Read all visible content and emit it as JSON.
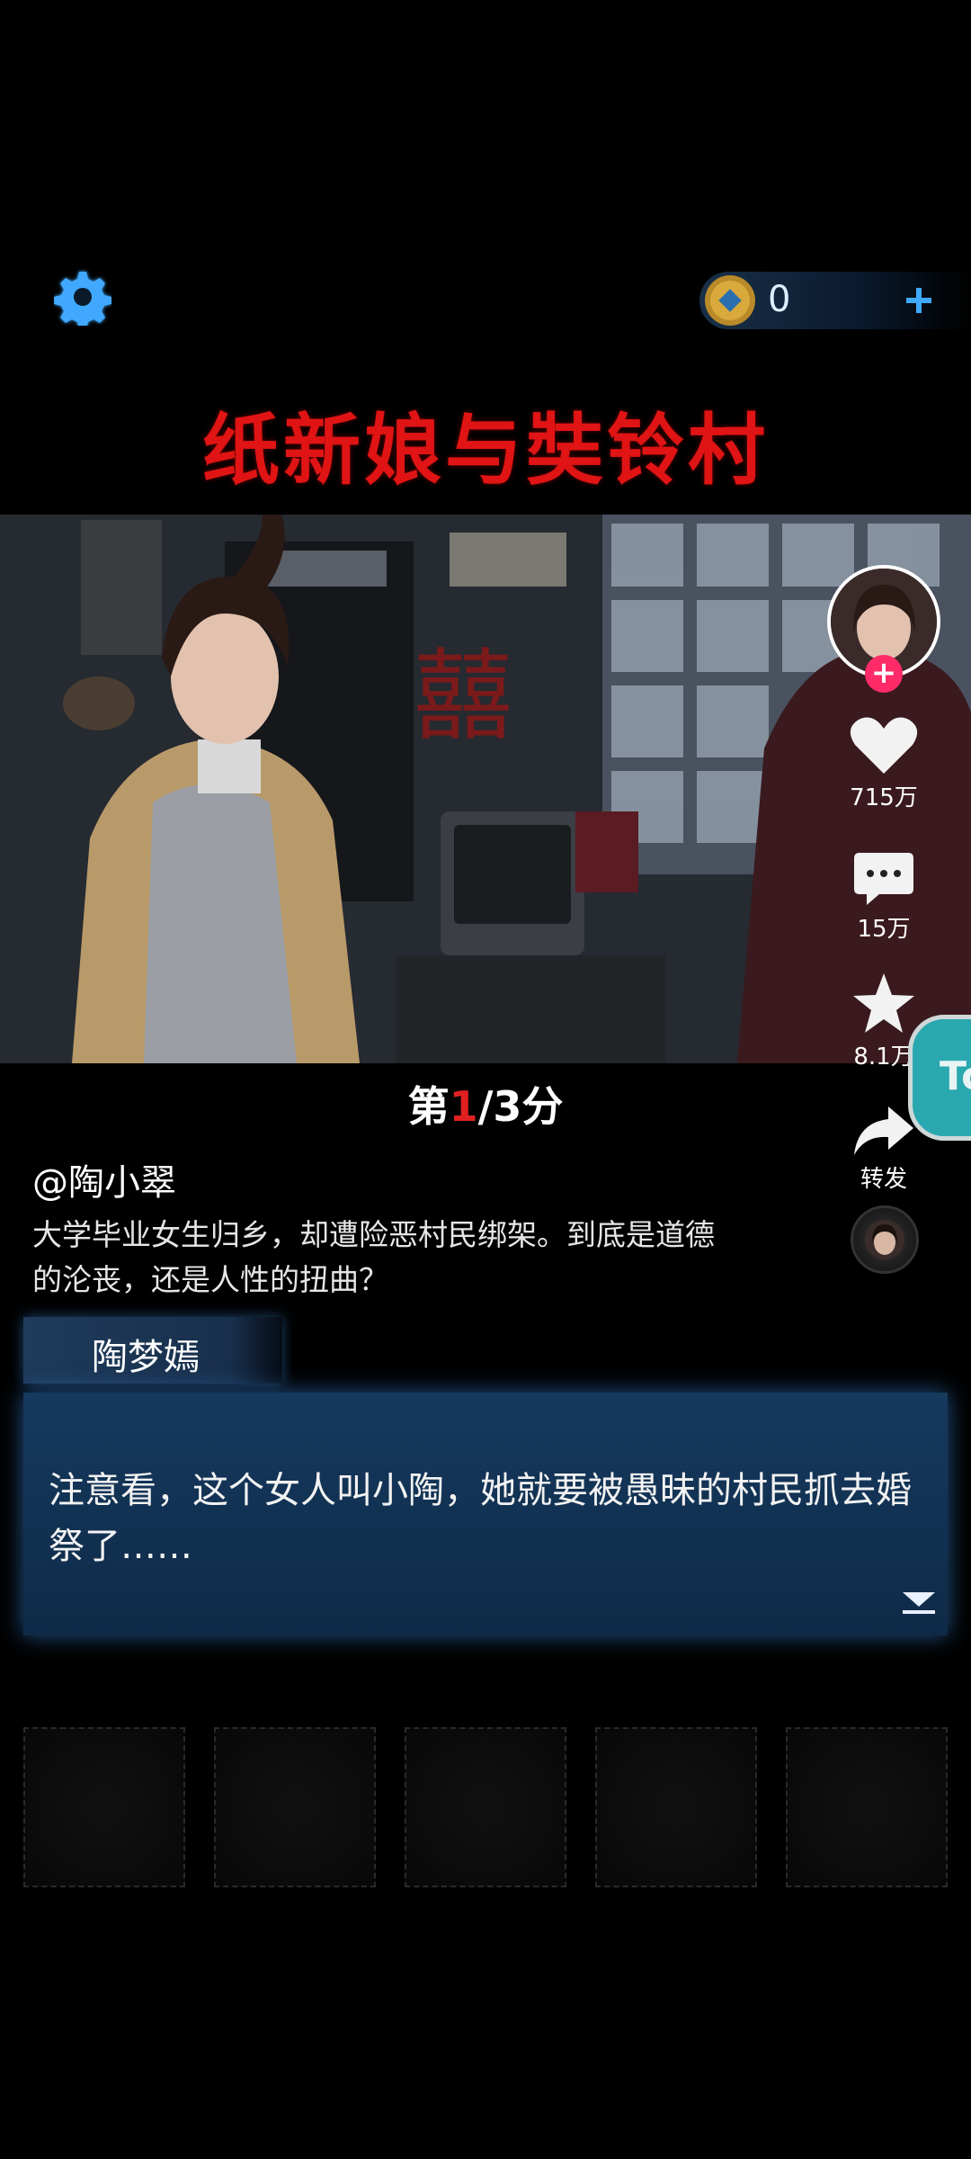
{
  "header": {
    "coins": "0",
    "settings_icon": "gear-icon",
    "coin_icon": "coin-icon",
    "add_icon": "plus-icon"
  },
  "game": {
    "title": "纸新娘与奘铃村",
    "scene_text": "囍"
  },
  "side_actions": {
    "likes": "715万",
    "comments": "15万",
    "favorites": "8.1万",
    "share": "转发"
  },
  "floating_badge": "Tc",
  "progress": {
    "prefix": "第",
    "current": "1",
    "suffix": "/3分"
  },
  "post": {
    "author": "@陶小翠",
    "description": "大学毕业女生归乡，却遭险恶村民绑架。到底是道德的沦丧，还是人性的扭曲？"
  },
  "dialog": {
    "speaker": "陶梦嫣",
    "text": "注意看，这个女人叫小陶，她就要被愚昧的村民抓去婚祭了……"
  },
  "colors": {
    "title_red": "#e01414",
    "accent_blue": "#3fa9ff",
    "follow_pink": "#ff2a68"
  }
}
